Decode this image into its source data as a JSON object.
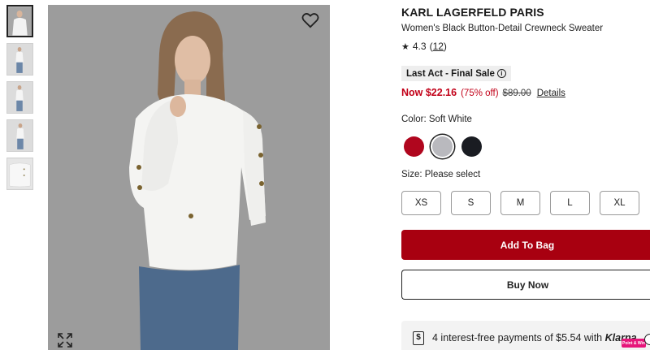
{
  "gallery": {
    "thumbnails": [
      "thumb-front",
      "thumb-model-full",
      "thumb-model-walk",
      "thumb-model-side",
      "thumb-flat-detail"
    ]
  },
  "product": {
    "brand": "KARL LAGERFELD PARIS",
    "name": "Women's Black Button-Detail Crewneck Sweater",
    "rating": "4.3",
    "review_count": "12",
    "rating_icon": "star-icon"
  },
  "sale": {
    "badge": "Last Act - Final Sale",
    "badge_icon": "info-icon",
    "now_price": "Now $22.16",
    "discount": "(75% off)",
    "original_price": "$89.00",
    "details_link": "Details"
  },
  "color": {
    "label": "Color: Soft White",
    "swatches": [
      {
        "name": "red",
        "hex": "#b0061e"
      },
      {
        "name": "soft-white",
        "hex": "#b9b9be",
        "selected": true
      },
      {
        "name": "black",
        "hex": "#1a1c22"
      }
    ]
  },
  "size": {
    "label": "Size: Please select",
    "options": [
      "XS",
      "S",
      "M",
      "L",
      "XL"
    ]
  },
  "actions": {
    "add_to_bag": "Add To Bag",
    "buy_now": "Buy Now"
  },
  "payments": {
    "text": "4 interest-free payments of $5.54 with ",
    "provider": "Klarna.",
    "icon": "dollar-icon"
  },
  "feedback_badge": "Point & Win",
  "colors": {
    "sale_red": "#c20018",
    "cta_red": "#a80010",
    "badge_bg": "#eeeeee"
  }
}
